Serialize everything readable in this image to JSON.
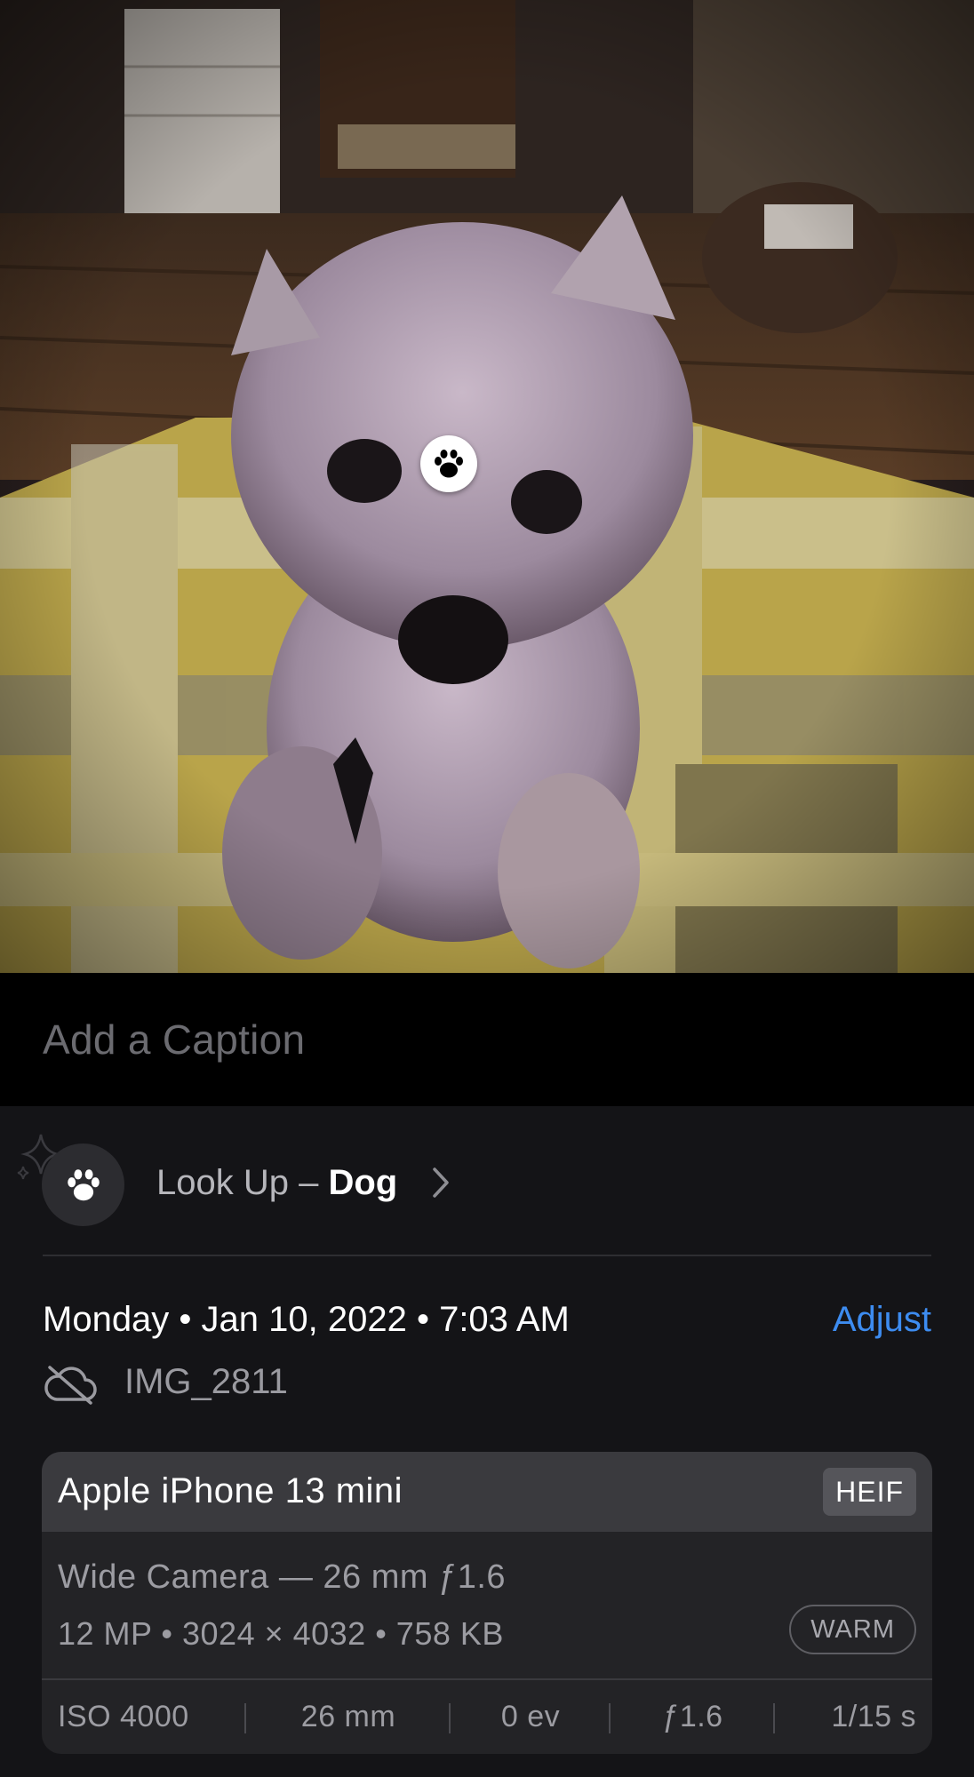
{
  "photo": {
    "subject_icon": "paw-icon"
  },
  "caption": {
    "placeholder": "Add a Caption"
  },
  "lookup": {
    "prefix": "Look Up – ",
    "subject": "Dog",
    "icon": "paw-icon"
  },
  "details": {
    "date": "Monday • Jan 10, 2022 • 7:03 AM",
    "adjust_label": "Adjust",
    "filename": "IMG_2811",
    "cloud_icon": "cloud-off-icon"
  },
  "camera": {
    "device": "Apple iPhone 13 mini",
    "format": "HEIF",
    "lens": "Wide Camera — 26 mm ƒ1.6",
    "specs": "12 MP  •  3024 × 4032  •  758 KB",
    "style_badge": "WARM",
    "exif": [
      "ISO 4000",
      "26 mm",
      "0 ev",
      "ƒ1.6",
      "1/15 s"
    ]
  },
  "colors": {
    "accent": "#3d8cf0",
    "panel": "#141417",
    "card": "#232326",
    "card_header": "#3a3a3e"
  }
}
